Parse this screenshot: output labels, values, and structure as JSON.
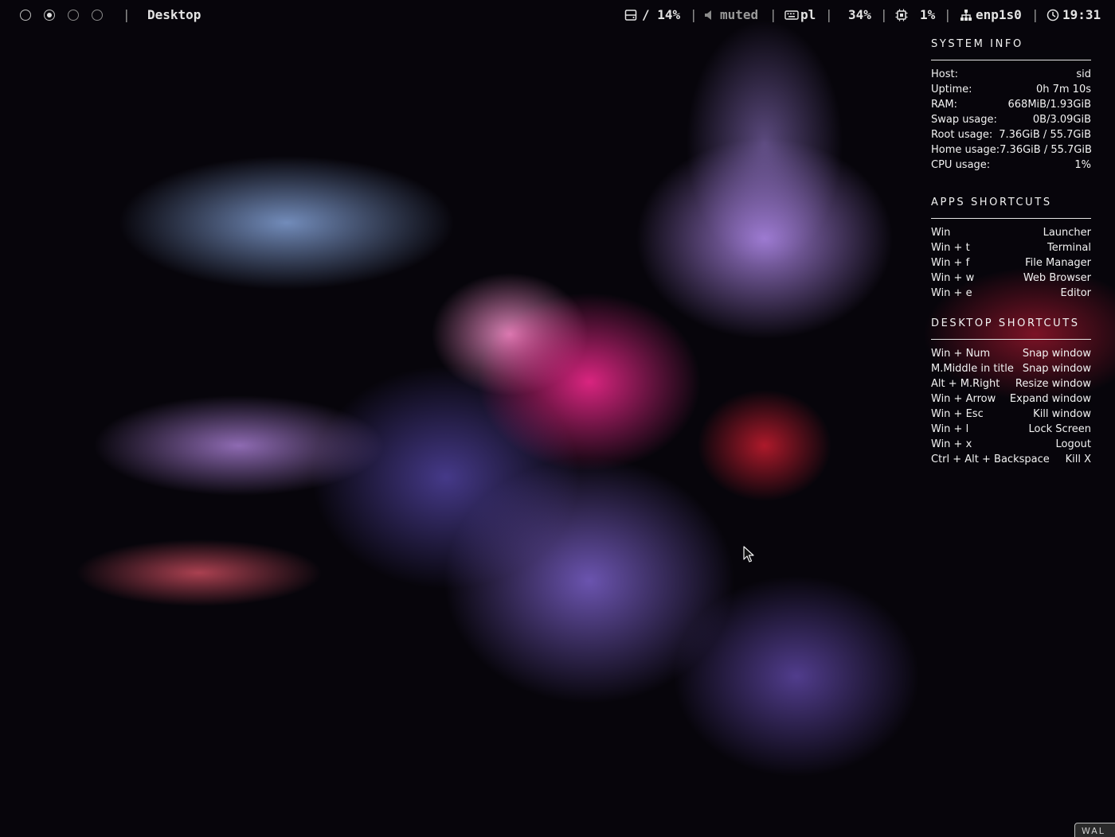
{
  "topbar": {
    "workspaces": [
      {
        "state": "outline"
      },
      {
        "state": "active"
      },
      {
        "state": "dim"
      },
      {
        "state": "dim"
      }
    ],
    "separator": "|",
    "window_title": "Desktop",
    "disk": {
      "icon": "disk-icon",
      "value": "/ 14%"
    },
    "volume": {
      "icon": "speaker-icon",
      "value": "muted"
    },
    "keyboard": {
      "icon": "keyboard-icon",
      "value": "pl"
    },
    "battery": {
      "icon": "battery-icon",
      "value": "34%"
    },
    "cpu": {
      "icon": "cpu-icon",
      "value": "1%"
    },
    "network": {
      "icon": "network-icon",
      "value": "enp1s0"
    },
    "clock": {
      "icon": "clock-icon",
      "value": "19:31"
    }
  },
  "panel": {
    "system_info": {
      "title": "SYSTEM INFO",
      "rows": [
        {
          "label": "Host:",
          "value": "sid"
        },
        {
          "label": "Uptime:",
          "value": "0h 7m 10s"
        },
        {
          "label": "RAM:",
          "value": "668MiB/1.93GiB"
        },
        {
          "label": "Swap usage:",
          "value": "0B/3.09GiB"
        },
        {
          "label": "Root usage:",
          "value": "7.36GiB / 55.7GiB"
        },
        {
          "label": "Home usage:",
          "value": "7.36GiB / 55.7GiB"
        },
        {
          "label": "CPU usage:",
          "value": "1%"
        }
      ]
    },
    "apps_shortcuts": {
      "title": "APPS SHORTCUTS",
      "rows": [
        {
          "label": "Win",
          "value": "Launcher"
        },
        {
          "label": "Win + t",
          "value": "Terminal"
        },
        {
          "label": "Win + f",
          "value": "File Manager"
        },
        {
          "label": "Win + w",
          "value": "Web Browser"
        },
        {
          "label": "Win + e",
          "value": "Editor"
        }
      ]
    },
    "desktop_shortcuts": {
      "title": "DESKTOP SHORTCUTS",
      "rows": [
        {
          "label": "Win + Num",
          "value": "Snap window"
        },
        {
          "label": "M.Middle in title",
          "value": "Snap window"
        },
        {
          "label": "Alt + M.Right",
          "value": "Resize window"
        },
        {
          "label": "Win + Arrow",
          "value": "Expand window"
        },
        {
          "label": "Win + Esc",
          "value": "Kill window"
        },
        {
          "label": "Win + l",
          "value": "Lock Screen"
        },
        {
          "label": "Win + x",
          "value": "Logout"
        },
        {
          "label": "Ctrl + Alt + Backspace",
          "value": "Kill X"
        }
      ]
    }
  },
  "watermark": "WAL",
  "colors": {
    "bar_text": "#e4e4e4",
    "muted_text": "#9a9a9a",
    "panel_text": "#f2f2f2",
    "background": "#07050b"
  }
}
